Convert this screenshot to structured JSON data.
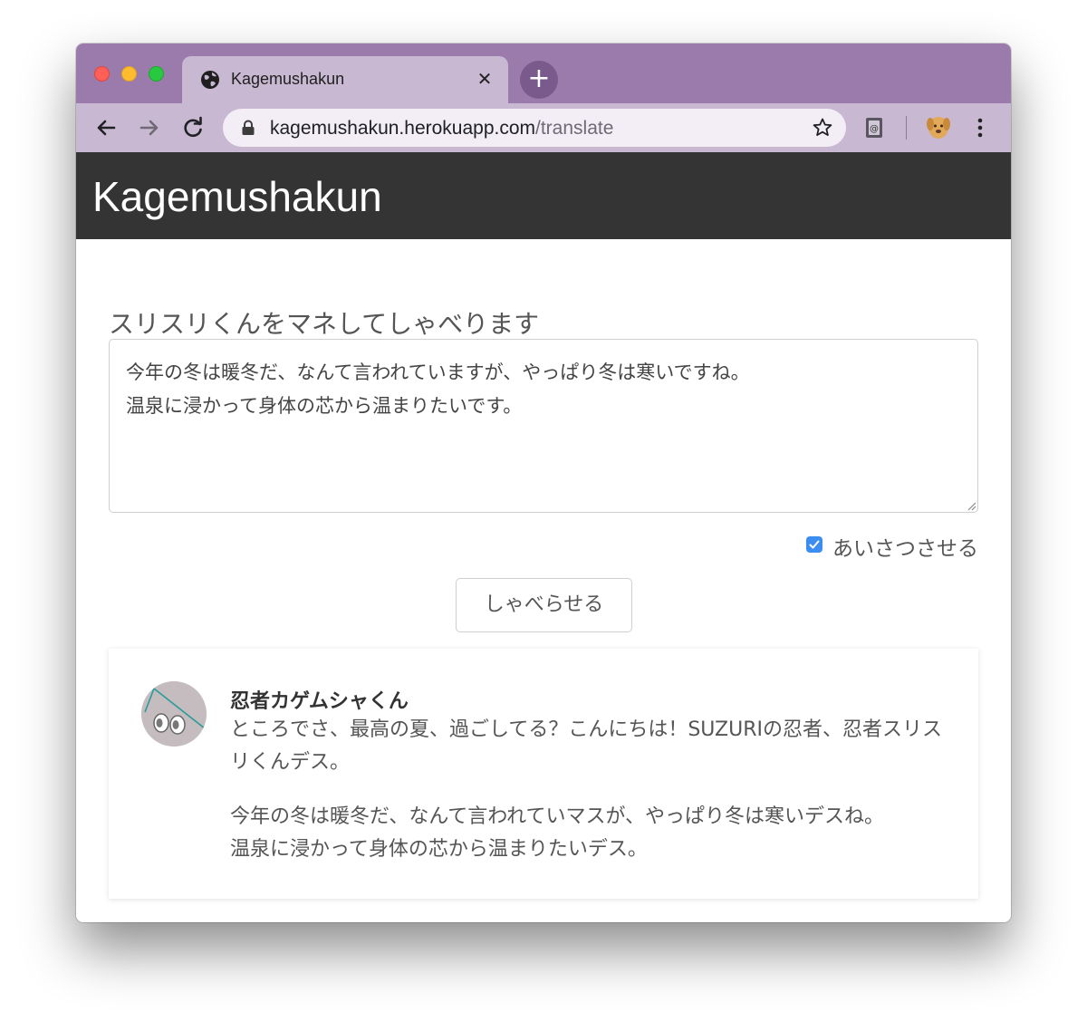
{
  "browser": {
    "tab_title": "Kagemushakun",
    "url_host": "kagemushakun.herokuapp.com",
    "url_path": "/translate"
  },
  "navbar": {
    "brand": "Kagemushakun"
  },
  "form": {
    "label": "スリスリくんをマネしてしゃべります",
    "textarea_value": "今年の冬は暖冬だ、なんて言われていますが、やっぱり冬は寒いですね。\n温泉に浸かって身体の芯から温まりたいです。",
    "checkbox_label": "あいさつさせる",
    "checkbox_checked": true,
    "submit_label": "しゃべらせる"
  },
  "result": {
    "speaker_name": "忍者カゲムシャくん",
    "greeting": "ところでさ、最高の夏、過ごしてる？こんにちは！SUZURIの忍者、忍者スリスリくんデス。",
    "body": "今年の冬は暖冬だ、なんて言われていマスが、やっぱり冬は寒いデスね。\n温泉に浸かって身体の芯から温まりたいデス。"
  },
  "colors": {
    "titlebar": "#9b7bab",
    "toolbar": "#c8b8d2",
    "navbar": "#343434",
    "checkbox": "#3b8df1"
  }
}
